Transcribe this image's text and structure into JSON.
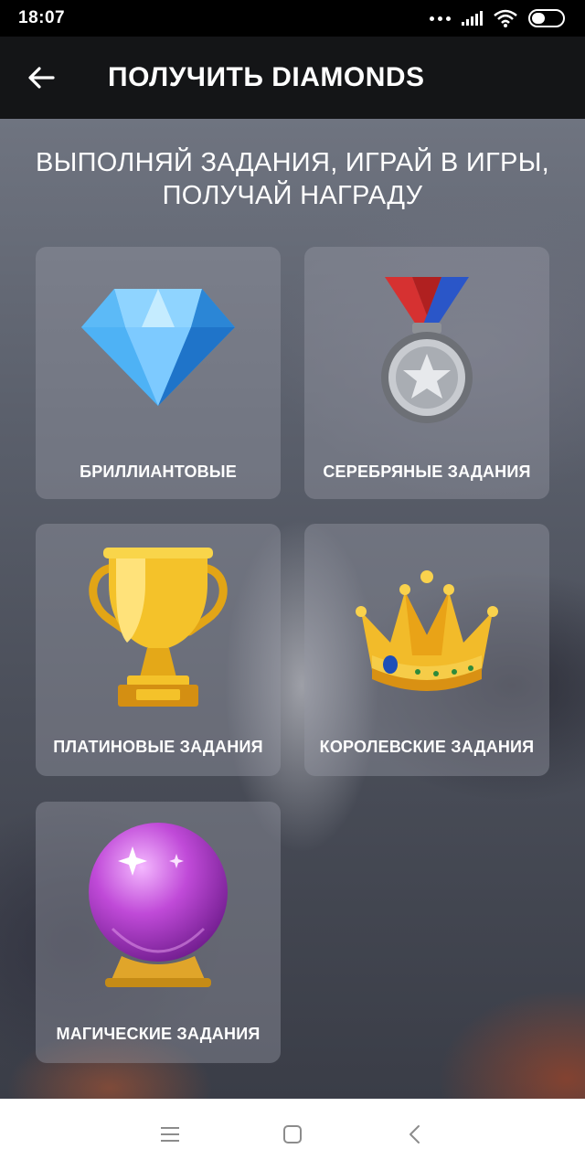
{
  "status_bar": {
    "time": "18:07",
    "icons": [
      "more-dots-icon",
      "signal-icon",
      "wifi-icon",
      "battery-icon"
    ]
  },
  "app_bar": {
    "back_icon": "arrow-left-icon",
    "title": "ПОЛУЧИТЬ DIAMONDS"
  },
  "headline": {
    "line1": "ВЫПОЛНЯЙ ЗАДАНИЯ, ИГРАЙ В ИГРЫ,",
    "line2": "ПОЛУЧАЙ НАГРАДУ"
  },
  "cards": [
    {
      "label": "БРИЛЛИАНТОВЫЕ",
      "icon": "diamond-icon"
    },
    {
      "label": "СЕРЕБРЯНЫЕ ЗАДАНИЯ",
      "icon": "silver-medal-icon"
    },
    {
      "label": "ПЛАТИНОВЫЕ ЗАДАНИЯ",
      "icon": "trophy-icon"
    },
    {
      "label": "КОРОЛЕВСКИЕ ЗАДАНИЯ",
      "icon": "crown-icon"
    },
    {
      "label": "МАГИЧЕСКИЕ ЗАДАНИЯ",
      "icon": "crystal-ball-icon"
    }
  ],
  "nav_bar": {
    "buttons": [
      "menu-icon",
      "home-square-icon",
      "back-chevron-icon"
    ]
  },
  "colors": {
    "status_bar_bg": "#000000",
    "app_bar_bg": "#141517",
    "card_bg": "rgba(150,152,165,0.42)",
    "text": "#ffffff"
  }
}
